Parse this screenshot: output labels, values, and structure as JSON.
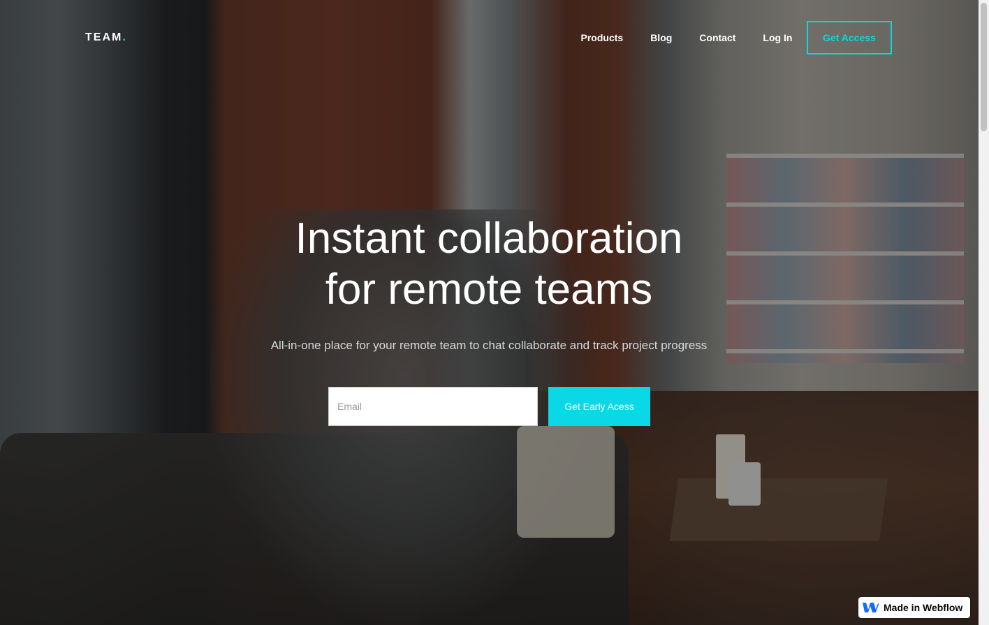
{
  "brand": {
    "name": "TEAM",
    "dot": ".",
    "accent_color": "#0bdae6"
  },
  "nav": {
    "items": [
      {
        "label": "Products"
      },
      {
        "label": "Blog"
      },
      {
        "label": "Contact"
      },
      {
        "label": "Log In"
      }
    ],
    "cta_label": "Get Access"
  },
  "hero": {
    "title_line1": "Instant collaboration",
    "title_line2": "for remote teams",
    "subtitle": "All-in-one place for your remote team to chat collaborate and track project progress",
    "email_placeholder": "Email",
    "email_value": "",
    "submit_label": "Get Early Acess"
  },
  "badge": {
    "label": "Made in Webflow",
    "icon": "webflow-icon"
  },
  "colors": {
    "accent": "#0ad8e6",
    "text": "#ffffff"
  }
}
